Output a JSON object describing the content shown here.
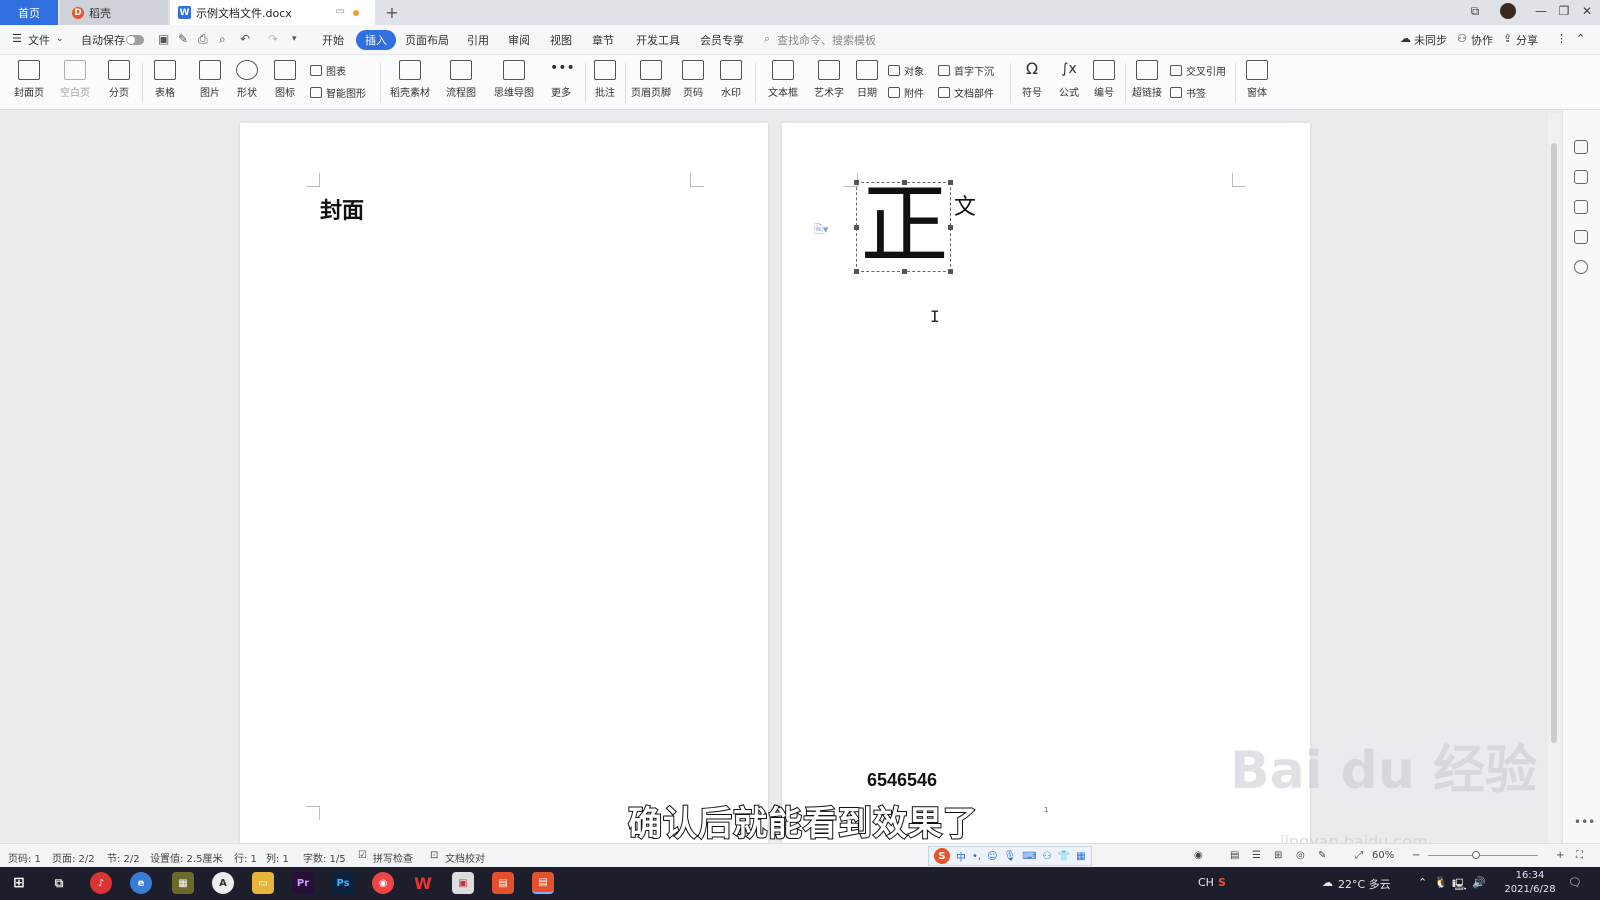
{
  "tabs": {
    "home": "首页",
    "daoke": "稻壳",
    "document": "示例文档文件.docx",
    "add": "+"
  },
  "menubar": {
    "file": "文件",
    "autosave": "自动保存",
    "items": [
      "开始",
      "插入",
      "页面布局",
      "引用",
      "审阅",
      "视图",
      "章节",
      "开发工具",
      "会员专享"
    ],
    "active": "插入",
    "search_placeholder": "查找命令、搜索模板",
    "not_synced": "未同步",
    "collaborate": "协作",
    "share": "分享"
  },
  "ribbon": {
    "cover_page": "封面页",
    "blank_page": "空白页",
    "page_break": "分页",
    "table": "表格",
    "picture": "图片",
    "shape": "形状",
    "icon": "图标",
    "chart": "图表",
    "smart_shape": "智能图形",
    "daoke_material": "稻壳素材",
    "flowchart": "流程图",
    "mindmap": "思维导图",
    "more": "更多",
    "comment": "批注",
    "header_footer": "页眉页脚",
    "page_number": "页码",
    "watermark": "水印",
    "textbox": "文本框",
    "wordart": "艺术字",
    "date": "日期",
    "object": "对象",
    "attachment": "附件",
    "dropcap": "首字下沉",
    "doc_parts": "文档部件",
    "symbol": "符号",
    "formula": "公式",
    "numbering": "编号",
    "hyperlink": "超链接",
    "cross_ref": "交叉引用",
    "bookmark": "书签",
    "form": "窗体"
  },
  "document": {
    "cover_title": "封面",
    "dropcap_char": "正",
    "dropcap_rest": "文",
    "footer_number": "6546546",
    "small_page_number": "1"
  },
  "subtitle": "确认后就能看到效果了",
  "watermark": {
    "main": "Bai du 经验",
    "sub": "jingyan.baidu.com"
  },
  "statusbar": {
    "page": "页码: 1",
    "pages": "页面: 2/2",
    "section": "节: 2/2",
    "setting": "设置值: 2.5厘米",
    "row": "行: 1",
    "col": "列: 1",
    "words": "字数: 1/5",
    "spellcheck": "拼写检查",
    "proofread": "文档校对",
    "zoom": "60%"
  },
  "ime": {
    "mode": "中"
  },
  "taskbar": {
    "lang": "CH",
    "weather": "22°C 多云",
    "time": "16:34",
    "date": "2021/6/28"
  },
  "colors": {
    "accent": "#2f6fe0",
    "taskbar": "#1c1f2b",
    "page": "#ffffff",
    "workspace": "#e9ebee"
  }
}
